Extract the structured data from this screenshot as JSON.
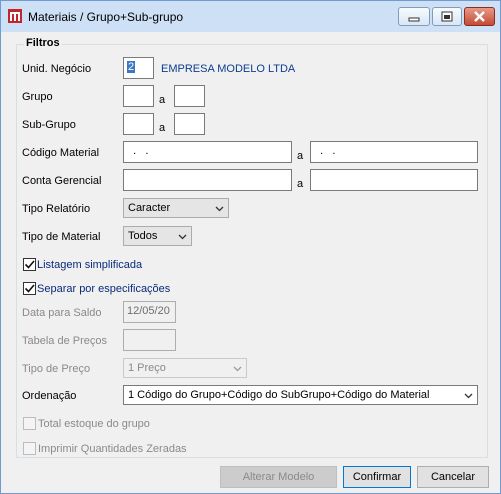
{
  "window": {
    "title": "Materiais / Grupo+Sub-grupo"
  },
  "filters": {
    "title": "Filtros",
    "unid_negocio": {
      "label": "Unid. Negócio",
      "value": "2",
      "company_name": "EMPRESA MODELO LTDA"
    },
    "grupo": {
      "label": "Grupo",
      "from": "",
      "separator": "a",
      "to": ""
    },
    "sub_grupo": {
      "label": "Sub-Grupo",
      "from": "",
      "separator": "a",
      "to": ""
    },
    "codigo_material": {
      "label": "Código Material",
      "from": "  .   .",
      "separator": "a",
      "to": "  .   ."
    },
    "conta_gerencial": {
      "label": "Conta Gerencial",
      "from": "",
      "separator": "a",
      "to": ""
    },
    "tipo_relatorio": {
      "label": "Tipo Relatório",
      "value": "Caracter"
    },
    "tipo_material": {
      "label": "Tipo de Material",
      "value": "Todos"
    },
    "listagem_simplificada": {
      "label": "Listagem simplificada",
      "checked": true
    },
    "separar_especificacoes": {
      "label": "Separar por especificações",
      "checked": true
    },
    "data_saldo": {
      "label": "Data para Saldo",
      "value": "12/05/20"
    },
    "tabela_precos": {
      "label": "Tabela de Preços",
      "value": ""
    },
    "tipo_preco": {
      "label": "Tipo de Preço",
      "value": "1 Preço"
    },
    "ordenacao": {
      "label": "Ordenação",
      "value": "1 Código do Grupo+Código do SubGrupo+Código do Material"
    },
    "total_estoque": {
      "label": "Total estoque do grupo",
      "checked": false
    },
    "imprimir_zeradas": {
      "label": "Imprimir Quantidades Zeradas",
      "checked": false
    }
  },
  "buttons": {
    "alterar_modelo": "Alterar Modelo",
    "confirmar": "Confirmar",
    "cancelar": "Cancelar"
  },
  "colors": {
    "titlebar": "#cde0f5",
    "selection": "#3a78c4",
    "company": "#0b3d91"
  }
}
